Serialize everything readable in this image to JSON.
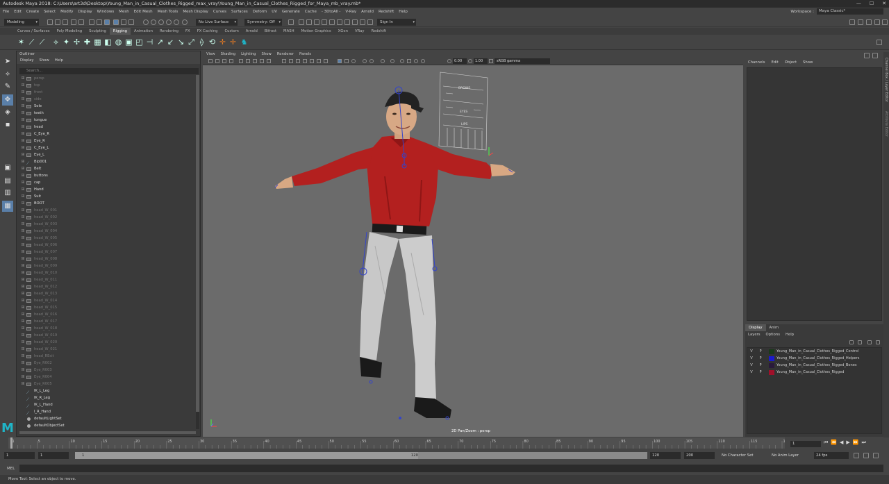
{
  "window": {
    "title": "Autodesk Maya 2018: C:\\Users\\art3d\\Desktop\\Young_Man_in_Casual_Clothes_Rigged_max_vray\\Young_Man_in_Casual_Clothes_Rigged_for_Maya_mb_vray.mb*",
    "min": "—",
    "max": "☐",
    "close": "✕"
  },
  "menubar": [
    "File",
    "Edit",
    "Create",
    "Select",
    "Modify",
    "Display",
    "Windows",
    "Mesh",
    "Edit Mesh",
    "Mesh Tools",
    "Mesh Display",
    "Curves",
    "Surfaces",
    "Deform",
    "UV",
    "Generate",
    "Cache",
    "- 3DtoAll -",
    "V-Ray",
    "Arnold",
    "Redshift",
    "Help"
  ],
  "workspace": {
    "label": "Workspace :",
    "value": "Maya Classic*"
  },
  "statusline": {
    "mode": "Modeling",
    "live_surface": "No Live Surface",
    "symmetry": "Symmetry: Off",
    "signin": "Sign In"
  },
  "shelf_tabs": [
    "Curves / Surfaces",
    "Poly Modeling",
    "Sculpting",
    "Rigging",
    "Animation",
    "Rendering",
    "FX",
    "FX Caching",
    "Custom",
    "Arnold",
    "Bifrost",
    "MASH",
    "Motion Graphics",
    "XGen",
    "VRay",
    "Redshift"
  ],
  "shelf_active": "Rigging",
  "outliner": {
    "title": "Outliner",
    "menu": [
      "Display",
      "Show",
      "Help"
    ],
    "search_placeholder": "Search...",
    "items": [
      {
        "name": "persp",
        "style": "dim",
        "kind": "cam"
      },
      {
        "name": "top",
        "style": "dim",
        "kind": "cam"
      },
      {
        "name": "front",
        "style": "dim",
        "kind": "cam"
      },
      {
        "name": "side",
        "style": "dim",
        "kind": "cam"
      },
      {
        "name": "Sole",
        "style": "bright",
        "kind": "mesh"
      },
      {
        "name": "teeth",
        "style": "bright",
        "kind": "mesh"
      },
      {
        "name": "tongue",
        "style": "bright",
        "kind": "mesh"
      },
      {
        "name": "head",
        "style": "bright",
        "kind": "mesh"
      },
      {
        "name": "C_Eye_R",
        "style": "bright",
        "kind": "mesh"
      },
      {
        "name": "Eye_R",
        "style": "bright",
        "kind": "mesh"
      },
      {
        "name": "C_Eye_L",
        "style": "bright",
        "kind": "mesh"
      },
      {
        "name": "Eye_L",
        "style": "bright",
        "kind": "mesh"
      },
      {
        "name": "Bip001",
        "style": "bright",
        "kind": "jnt"
      },
      {
        "name": "Belt",
        "style": "bright",
        "kind": "mesh"
      },
      {
        "name": "buttons",
        "style": "bright",
        "kind": "mesh"
      },
      {
        "name": "cap",
        "style": "bright",
        "kind": "mesh"
      },
      {
        "name": "Hand",
        "style": "bright",
        "kind": "mesh"
      },
      {
        "name": "Suit",
        "style": "bright",
        "kind": "mesh"
      },
      {
        "name": "BOOT",
        "style": "bright",
        "kind": "mesh"
      },
      {
        "name": "head_W_001",
        "style": "dim",
        "kind": "mesh"
      },
      {
        "name": "head_W_002",
        "style": "dim",
        "kind": "mesh"
      },
      {
        "name": "head_W_003",
        "style": "dim",
        "kind": "mesh"
      },
      {
        "name": "head_W_004",
        "style": "dim",
        "kind": "mesh"
      },
      {
        "name": "head_W_005",
        "style": "dim",
        "kind": "mesh"
      },
      {
        "name": "head_W_006",
        "style": "dim",
        "kind": "mesh"
      },
      {
        "name": "head_W_007",
        "style": "dim",
        "kind": "mesh"
      },
      {
        "name": "head_W_008",
        "style": "dim",
        "kind": "mesh"
      },
      {
        "name": "head_W_009",
        "style": "dim",
        "kind": "mesh"
      },
      {
        "name": "head_W_010",
        "style": "dim",
        "kind": "mesh"
      },
      {
        "name": "head_W_011",
        "style": "dim",
        "kind": "mesh"
      },
      {
        "name": "head_W_012",
        "style": "dim",
        "kind": "mesh"
      },
      {
        "name": "head_W_013",
        "style": "dim",
        "kind": "mesh"
      },
      {
        "name": "head_W_014",
        "style": "dim",
        "kind": "mesh"
      },
      {
        "name": "head_W_015",
        "style": "dim",
        "kind": "mesh"
      },
      {
        "name": "head_W_016",
        "style": "dim",
        "kind": "mesh"
      },
      {
        "name": "head_W_017",
        "style": "dim",
        "kind": "mesh"
      },
      {
        "name": "head_W_018",
        "style": "dim",
        "kind": "mesh"
      },
      {
        "name": "head_W_019",
        "style": "dim",
        "kind": "mesh"
      },
      {
        "name": "head_W_020",
        "style": "dim",
        "kind": "mesh"
      },
      {
        "name": "head_W_021",
        "style": "dim",
        "kind": "mesh"
      },
      {
        "name": "head_REsit",
        "style": "dim",
        "kind": "mesh"
      },
      {
        "name": "Eye_R002",
        "style": "dim",
        "kind": "mesh"
      },
      {
        "name": "Eye_R003",
        "style": "dim",
        "kind": "mesh"
      },
      {
        "name": "Eye_R004",
        "style": "dim",
        "kind": "mesh"
      },
      {
        "name": "Eye_R005",
        "style": "dim",
        "kind": "mesh"
      },
      {
        "name": "IK_L_Leg",
        "style": "bright",
        "kind": "jnt"
      },
      {
        "name": "IK_R_Leg",
        "style": "bright",
        "kind": "jnt"
      },
      {
        "name": "IK_L_Hand",
        "style": "bright",
        "kind": "jnt"
      },
      {
        "name": "I_R_Hand",
        "style": "bright",
        "kind": "jnt"
      },
      {
        "name": "defaultLightSet",
        "style": "bright",
        "kind": "set"
      },
      {
        "name": "defaultObjectSet",
        "style": "bright",
        "kind": "set"
      }
    ]
  },
  "viewport": {
    "menu": [
      "View",
      "Shading",
      "Lighting",
      "Show",
      "Renderer",
      "Panels"
    ],
    "exposure": "0.00",
    "gamma_value": "1.00",
    "color_space": "sRGB gamma",
    "label": "2D Pan/Zoom : persp",
    "gui_labels": [
      "BROWS",
      "EYES",
      "LIPS"
    ]
  },
  "channelbox": {
    "menu": [
      "Channels",
      "Edit",
      "Object",
      "Show"
    ]
  },
  "side_tabs": [
    "Channel Box / Layer Editor",
    "Attribute Editor"
  ],
  "layers": {
    "tabs": [
      "Display",
      "Anim"
    ],
    "menu": [
      "Layers",
      "Options",
      "Help"
    ],
    "rows": [
      {
        "v": "V",
        "p": "P",
        "color": "#1a3a1a",
        "name": "Young_Man_in_Casual_Clothes_Rigged_Control"
      },
      {
        "v": "V",
        "p": "P",
        "color": "#1a1acc",
        "name": "Young_Man_in_Casual_Clothes_Rigged_Helpers"
      },
      {
        "v": "V",
        "p": "P",
        "color": "#2a1a3a",
        "name": "Young_Man_in_Casual_Clothes_Rigged_Bones"
      },
      {
        "v": "V",
        "p": "P",
        "color": "#a0102a",
        "name": "Young_Man_in_Casual_Clothes_Rigged"
      }
    ]
  },
  "timeline": {
    "ticks": [
      "1",
      "5",
      "10",
      "15",
      "20",
      "25",
      "30",
      "35",
      "40",
      "45",
      "50",
      "55",
      "60",
      "65",
      "70",
      "75",
      "80",
      "85",
      "90",
      "95",
      "100",
      "105",
      "110",
      "115",
      "120"
    ],
    "current_frame": "1"
  },
  "range": {
    "start": "1",
    "start2": "1",
    "slider_start": "1",
    "slider_end": "120",
    "end": "120",
    "end2": "200",
    "character_set": "No Character Set",
    "anim_layer": "No Anim Layer",
    "fps": "24 fps"
  },
  "cmdline": {
    "label": "MEL"
  },
  "helpline": {
    "text": "Move Tool: Select an object to move."
  },
  "colors": {
    "accent": "#1fb5c8",
    "shirt": "#b3201f",
    "pants": "#c9c9c9"
  }
}
